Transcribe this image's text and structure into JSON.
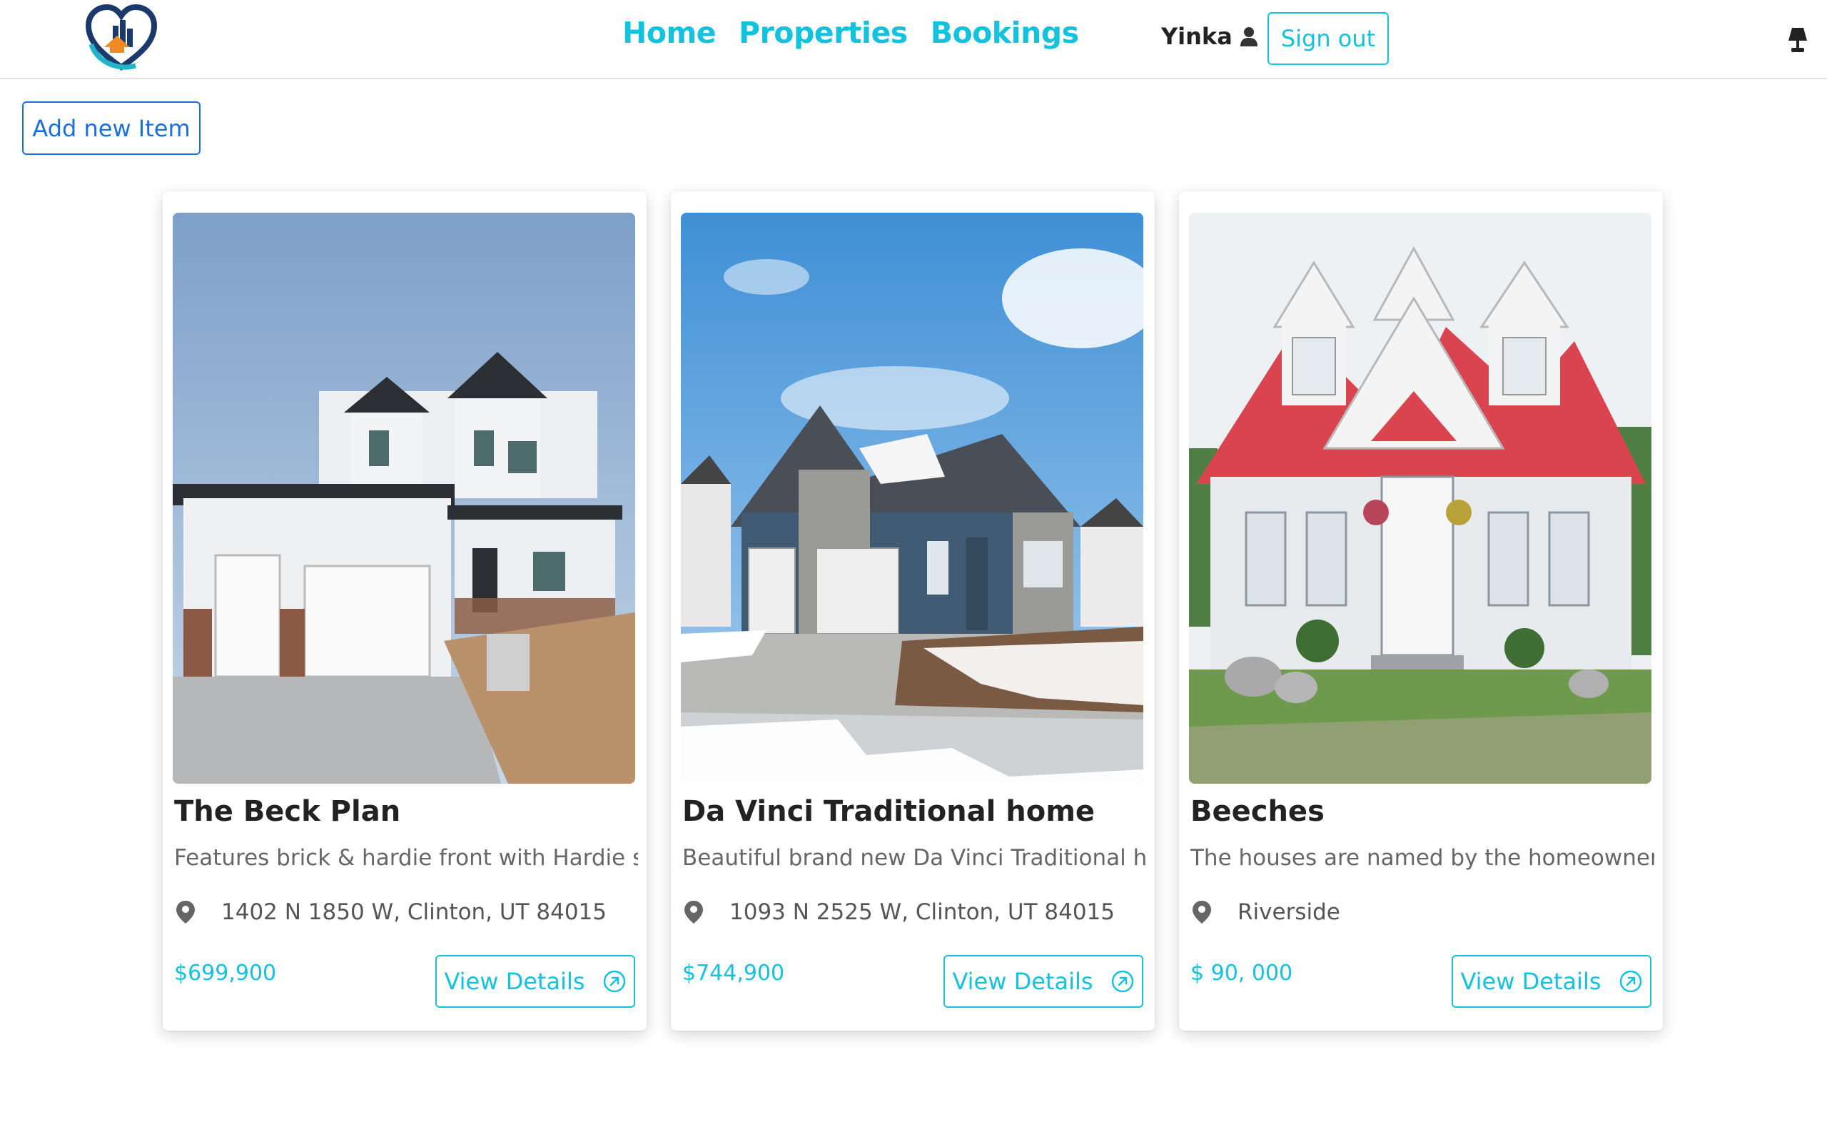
{
  "navbar": {
    "links": [
      {
        "label": "Home"
      },
      {
        "label": "Properties"
      },
      {
        "label": "Bookings"
      }
    ],
    "user_name": "Yinka",
    "user_icon": "user-icon",
    "signout_label": "Sign out",
    "theme_icon": "lamp-icon",
    "accent_color": "#13c2dc"
  },
  "actions": {
    "add_label": "Add new Item"
  },
  "cards": [
    {
      "title": "The Beck Plan",
      "description": "Features brick & hardie front with Hardie si...",
      "location": "1402 N 1850 W, Clinton, UT 84015",
      "price": "$699,900",
      "button_label": "View Details"
    },
    {
      "title": "Da Vinci Traditional home",
      "description": "Beautiful brand new Da Vinci Traditional ho...",
      "location": "1093 N 2525 W, Clinton, UT 84015",
      "price": "$744,900",
      "button_label": "View Details"
    },
    {
      "title": "Beeches",
      "description": "The houses are named by the homeowners ...",
      "location": "Riverside",
      "price": "$ 90, 000",
      "button_label": "View Details"
    }
  ]
}
